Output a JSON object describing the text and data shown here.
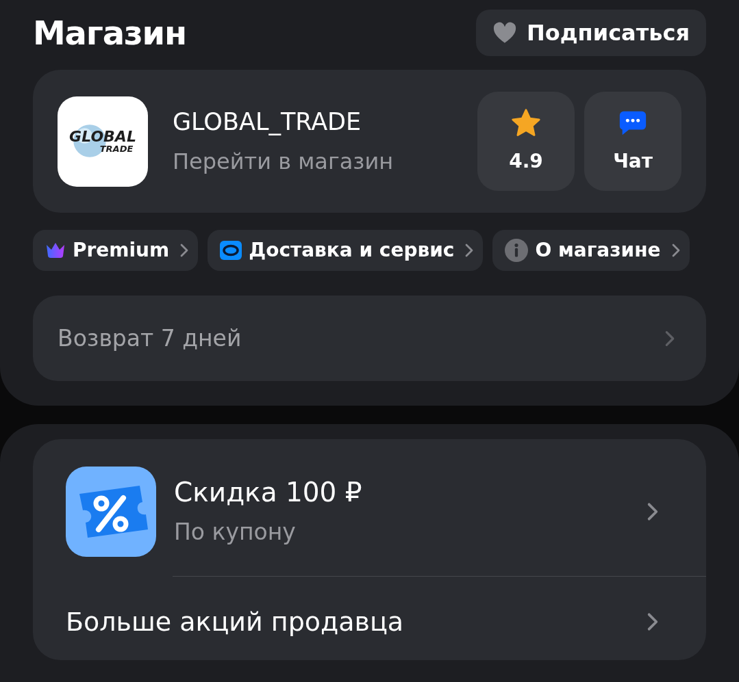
{
  "header": {
    "title": "Магазин",
    "subscribe_button": {
      "label": "Подписаться",
      "subscribed": false
    }
  },
  "shop": {
    "logo_text": [
      "GLOBAL",
      "TRADE"
    ],
    "name": "GLOBAL_TRADE",
    "link": "Перейти в магазин",
    "rating": "4.9",
    "chat": "Чат"
  },
  "chips": [
    {
      "kind": "premium",
      "label": "Premium"
    },
    {
      "kind": "delivery",
      "label": "Доставка и сервис"
    },
    {
      "kind": "info",
      "label": "О магазине"
    }
  ],
  "return_policy": "Возврат 7 дней",
  "promos": [
    {
      "kind": "coupon",
      "title": "Скидка 100 ₽",
      "subtitle": "По купону"
    },
    {
      "kind": "link",
      "title": "Больше акций продавца"
    }
  ]
}
